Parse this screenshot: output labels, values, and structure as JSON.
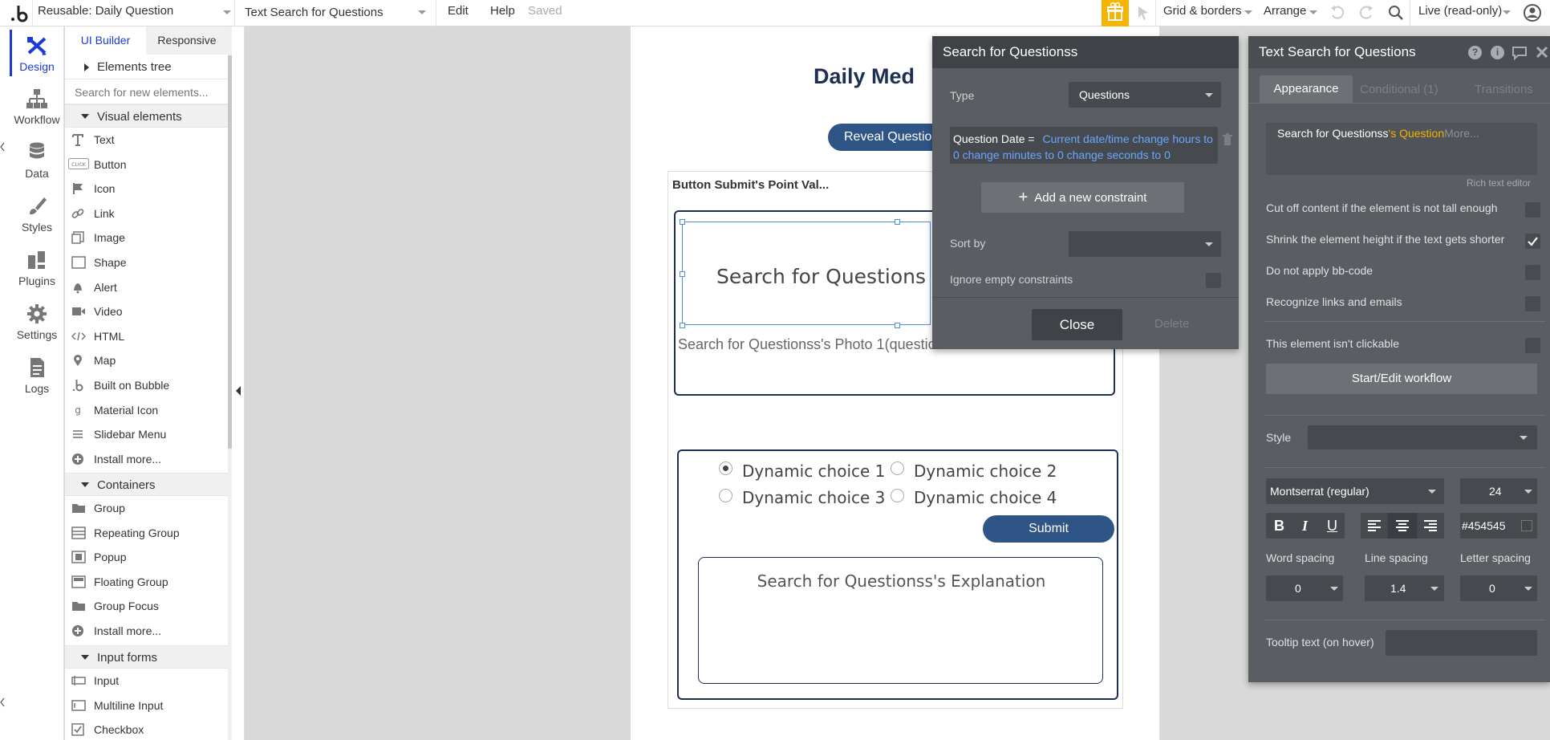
{
  "topbar": {
    "page_select": "Reusable: Daily Question",
    "element_select": "Text Search for Questions",
    "menu_edit": "Edit",
    "menu_help": "Help",
    "saved_status": "Saved",
    "grid_borders": "Grid & borders",
    "arrange": "Arrange",
    "live_mode": "Live (read-only)"
  },
  "rail": {
    "items": [
      {
        "label": "Design",
        "icon": "design-icon"
      },
      {
        "label": "Workflow",
        "icon": "workflow-icon"
      },
      {
        "label": "Data",
        "icon": "database-icon"
      },
      {
        "label": "Styles",
        "icon": "brush-icon"
      },
      {
        "label": "Plugins",
        "icon": "plugin-icon"
      },
      {
        "label": "Settings",
        "icon": "gear-icon"
      },
      {
        "label": "Logs",
        "icon": "document-icon"
      }
    ]
  },
  "palette": {
    "tab_ui_builder": "UI Builder",
    "tab_responsive": "Responsive",
    "elements_tree": "Elements tree",
    "search_placeholder": "Search for new elements...",
    "visual_section": "Visual elements",
    "visual_items": [
      "Text",
      "Button",
      "Icon",
      "Link",
      "Image",
      "Shape",
      "Alert",
      "Video",
      "HTML",
      "Map",
      "Built on Bubble",
      "Material Icon",
      "Slidebar Menu",
      "Install more..."
    ],
    "containers_section": "Containers",
    "container_items": [
      "Group",
      "Repeating Group",
      "Popup",
      "Floating Group",
      "Group Focus",
      "Install more..."
    ],
    "inputs_section": "Input forms",
    "input_items": [
      "Input",
      "Multiline Input",
      "Checkbox"
    ]
  },
  "canvas": {
    "page_title": "Daily Med",
    "reveal_button": "Reveal Questio",
    "point_value_text": "Button Submit's Point Val...",
    "question_text": "Search for Questions",
    "photo_text": "Search for Questionss's Photo 1(questio",
    "choices": [
      "Dynamic choice 1",
      "Dynamic choice 2",
      "Dynamic choice 3",
      "Dynamic choice 4"
    ],
    "submit_button": "Submit",
    "explanation_text": "Search for Questionss's Explanation"
  },
  "search_popup": {
    "title": "Search for Questionss",
    "type_label": "Type",
    "type_value": "Questions",
    "constraint_key": "Question Date =",
    "constraint_value": "Current date/time change hours to 0 change minutes to 0 change seconds to 0",
    "add_constraint": "Add a new constraint",
    "sort_by_label": "Sort by",
    "ignore_empty_label": "Ignore empty constraints",
    "close_button": "Close",
    "delete_button": "Delete"
  },
  "props": {
    "title": "Text Search for Questions",
    "tab_appearance": "Appearance",
    "tab_conditional": "Conditional (1)",
    "tab_transitions": "Transitions",
    "expr_source": "Search for Questionss",
    "expr_field": "'s Question",
    "expr_more": "More...",
    "rich_text_editor": "Rich text editor",
    "opt_cutoff": "Cut off content if the element is not tall enough",
    "opt_shrink": "Shrink the element height if the text gets shorter",
    "opt_bbcode": "Do not apply bb-code",
    "opt_links": "Recognize links and emails",
    "opt_not_clickable": "This element isn't clickable",
    "workflow_button": "Start/Edit workflow",
    "style_label": "Style",
    "font_family": "Montserrat (regular)",
    "font_size": "24",
    "bold": "B",
    "italic": "I",
    "underline": "U",
    "color_value": "#454545",
    "word_spacing_label": "Word spacing",
    "line_spacing_label": "Line spacing",
    "letter_spacing_label": "Letter spacing",
    "word_spacing": "0",
    "line_spacing": "1.4",
    "letter_spacing": "0",
    "tooltip_label": "Tooltip text (on hover)"
  },
  "colors": {
    "accent_blue": "#1b3ad8",
    "navy_button": "#2f5486",
    "popup_bg": "#5a5d61",
    "highlight_yellow": "#f5b400",
    "link_blue": "#6ba6ff"
  }
}
